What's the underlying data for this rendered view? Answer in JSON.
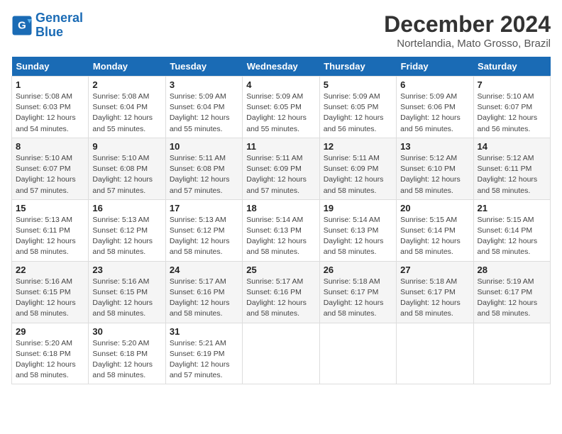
{
  "header": {
    "logo_line1": "General",
    "logo_line2": "Blue",
    "month_title": "December 2024",
    "location": "Nortelandia, Mato Grosso, Brazil"
  },
  "weekdays": [
    "Sunday",
    "Monday",
    "Tuesday",
    "Wednesday",
    "Thursday",
    "Friday",
    "Saturday"
  ],
  "weeks": [
    [
      {
        "day": "1",
        "info": "Sunrise: 5:08 AM\nSunset: 6:03 PM\nDaylight: 12 hours\nand 54 minutes."
      },
      {
        "day": "2",
        "info": "Sunrise: 5:08 AM\nSunset: 6:04 PM\nDaylight: 12 hours\nand 55 minutes."
      },
      {
        "day": "3",
        "info": "Sunrise: 5:09 AM\nSunset: 6:04 PM\nDaylight: 12 hours\nand 55 minutes."
      },
      {
        "day": "4",
        "info": "Sunrise: 5:09 AM\nSunset: 6:05 PM\nDaylight: 12 hours\nand 55 minutes."
      },
      {
        "day": "5",
        "info": "Sunrise: 5:09 AM\nSunset: 6:05 PM\nDaylight: 12 hours\nand 56 minutes."
      },
      {
        "day": "6",
        "info": "Sunrise: 5:09 AM\nSunset: 6:06 PM\nDaylight: 12 hours\nand 56 minutes."
      },
      {
        "day": "7",
        "info": "Sunrise: 5:10 AM\nSunset: 6:07 PM\nDaylight: 12 hours\nand 56 minutes."
      }
    ],
    [
      {
        "day": "8",
        "info": "Sunrise: 5:10 AM\nSunset: 6:07 PM\nDaylight: 12 hours\nand 57 minutes."
      },
      {
        "day": "9",
        "info": "Sunrise: 5:10 AM\nSunset: 6:08 PM\nDaylight: 12 hours\nand 57 minutes."
      },
      {
        "day": "10",
        "info": "Sunrise: 5:11 AM\nSunset: 6:08 PM\nDaylight: 12 hours\nand 57 minutes."
      },
      {
        "day": "11",
        "info": "Sunrise: 5:11 AM\nSunset: 6:09 PM\nDaylight: 12 hours\nand 57 minutes."
      },
      {
        "day": "12",
        "info": "Sunrise: 5:11 AM\nSunset: 6:09 PM\nDaylight: 12 hours\nand 58 minutes."
      },
      {
        "day": "13",
        "info": "Sunrise: 5:12 AM\nSunset: 6:10 PM\nDaylight: 12 hours\nand 58 minutes."
      },
      {
        "day": "14",
        "info": "Sunrise: 5:12 AM\nSunset: 6:11 PM\nDaylight: 12 hours\nand 58 minutes."
      }
    ],
    [
      {
        "day": "15",
        "info": "Sunrise: 5:13 AM\nSunset: 6:11 PM\nDaylight: 12 hours\nand 58 minutes."
      },
      {
        "day": "16",
        "info": "Sunrise: 5:13 AM\nSunset: 6:12 PM\nDaylight: 12 hours\nand 58 minutes."
      },
      {
        "day": "17",
        "info": "Sunrise: 5:13 AM\nSunset: 6:12 PM\nDaylight: 12 hours\nand 58 minutes."
      },
      {
        "day": "18",
        "info": "Sunrise: 5:14 AM\nSunset: 6:13 PM\nDaylight: 12 hours\nand 58 minutes."
      },
      {
        "day": "19",
        "info": "Sunrise: 5:14 AM\nSunset: 6:13 PM\nDaylight: 12 hours\nand 58 minutes."
      },
      {
        "day": "20",
        "info": "Sunrise: 5:15 AM\nSunset: 6:14 PM\nDaylight: 12 hours\nand 58 minutes."
      },
      {
        "day": "21",
        "info": "Sunrise: 5:15 AM\nSunset: 6:14 PM\nDaylight: 12 hours\nand 58 minutes."
      }
    ],
    [
      {
        "day": "22",
        "info": "Sunrise: 5:16 AM\nSunset: 6:15 PM\nDaylight: 12 hours\nand 58 minutes."
      },
      {
        "day": "23",
        "info": "Sunrise: 5:16 AM\nSunset: 6:15 PM\nDaylight: 12 hours\nand 58 minutes."
      },
      {
        "day": "24",
        "info": "Sunrise: 5:17 AM\nSunset: 6:16 PM\nDaylight: 12 hours\nand 58 minutes."
      },
      {
        "day": "25",
        "info": "Sunrise: 5:17 AM\nSunset: 6:16 PM\nDaylight: 12 hours\nand 58 minutes."
      },
      {
        "day": "26",
        "info": "Sunrise: 5:18 AM\nSunset: 6:17 PM\nDaylight: 12 hours\nand 58 minutes."
      },
      {
        "day": "27",
        "info": "Sunrise: 5:18 AM\nSunset: 6:17 PM\nDaylight: 12 hours\nand 58 minutes."
      },
      {
        "day": "28",
        "info": "Sunrise: 5:19 AM\nSunset: 6:17 PM\nDaylight: 12 hours\nand 58 minutes."
      }
    ],
    [
      {
        "day": "29",
        "info": "Sunrise: 5:20 AM\nSunset: 6:18 PM\nDaylight: 12 hours\nand 58 minutes."
      },
      {
        "day": "30",
        "info": "Sunrise: 5:20 AM\nSunset: 6:18 PM\nDaylight: 12 hours\nand 58 minutes."
      },
      {
        "day": "31",
        "info": "Sunrise: 5:21 AM\nSunset: 6:19 PM\nDaylight: 12 hours\nand 57 minutes."
      },
      {
        "day": "",
        "info": ""
      },
      {
        "day": "",
        "info": ""
      },
      {
        "day": "",
        "info": ""
      },
      {
        "day": "",
        "info": ""
      }
    ]
  ]
}
